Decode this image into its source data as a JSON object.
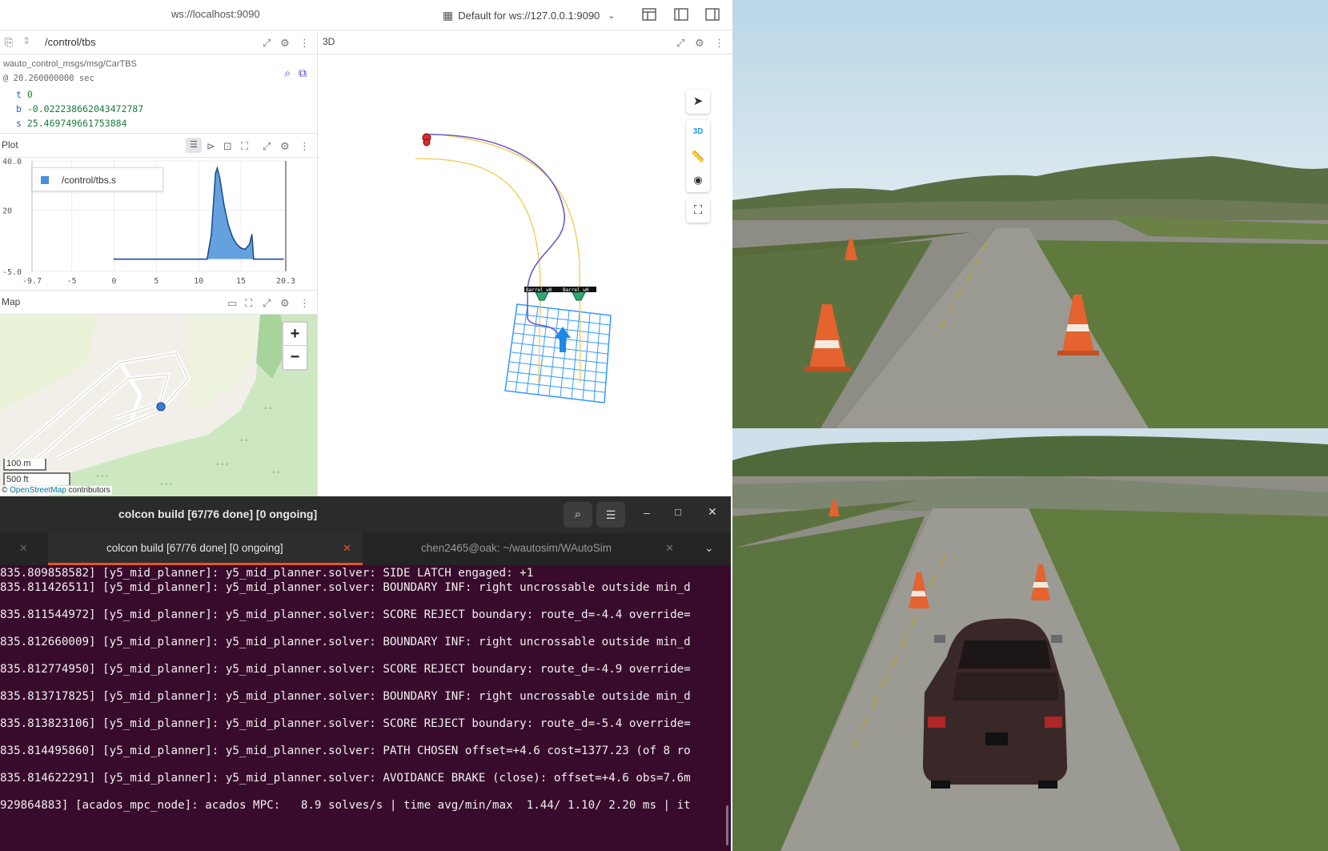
{
  "topbar": {
    "connection": "ws://localhost:9090",
    "layout_label": "Default for ws://127.0.0.1:9090"
  },
  "raw_panel": {
    "topic": "/control/tbs",
    "msg_type": "wauto_control_msgs/msg/CarTBS",
    "timestamp": "@ 20.260000000 sec",
    "fields": [
      {
        "key": "t",
        "value": "0"
      },
      {
        "key": "b",
        "value": "-0.022238662043472787"
      },
      {
        "key": "s",
        "value": "25.469749661753884"
      }
    ]
  },
  "plot_panel": {
    "title": "Plot",
    "legend_series": "/control/tbs.s",
    "series_color": "#4a90d9"
  },
  "chart_data": {
    "type": "area",
    "title": "",
    "xlabel": "",
    "ylabel": "",
    "xlim": [
      -9.7,
      20.3
    ],
    "ylim": [
      -5.0,
      40.0
    ],
    "x_ticks": [
      "-9.7",
      "-5",
      "0",
      "5",
      "10",
      "15",
      "20.3"
    ],
    "y_ticks": [
      "40.0",
      "20",
      "-5.0"
    ],
    "grid": true,
    "legend_position": "top-left",
    "series": [
      {
        "name": "/control/tbs.s",
        "x": [
          0,
          11,
          11.5,
          11.8,
          12,
          12.2,
          12.5,
          13,
          13.5,
          14,
          14.5,
          15,
          15.5,
          16,
          16.3,
          16.5,
          20
        ],
        "y": [
          0,
          0,
          10,
          25,
          35,
          37,
          33,
          22,
          14,
          9,
          6,
          4.5,
          4,
          6,
          10,
          0,
          0
        ]
      }
    ]
  },
  "map_panel": {
    "title": "Map",
    "zoom_in": "+",
    "zoom_out": "−",
    "scale_metric": "100 m",
    "scale_imperial": "500 ft",
    "attribution_prefix": "©",
    "attribution_link": "OpenStreetMap",
    "attribution_suffix": "contributors"
  },
  "panel3d": {
    "title": "3D",
    "mode_3d": "3D",
    "overlay_label_1": "Barrel_w0",
    "overlay_label_2": "Barrel_w0"
  },
  "terminal": {
    "window_title": "colcon build [67/76 done] [0 ongoing]",
    "tabs": [
      {
        "label": "colcon build [67/76 done] [0 ongoing]",
        "active": true
      },
      {
        "label": "chen2465@oak: ~/wautosim/WAutoSim",
        "active": false
      }
    ],
    "lines": [
      "835.809858582] [y5_mid_planner]: y5_mid_planner.solver: SIDE LATCH engaged: +1",
      "835.811426511] [y5_mid_planner]: y5_mid_planner.solver: BOUNDARY INF: right uncrossable outside min_d",
      "835.811544972] [y5_mid_planner]: y5_mid_planner.solver: SCORE REJECT boundary: route_d=-4.4 override=",
      "835.812660009] [y5_mid_planner]: y5_mid_planner.solver: BOUNDARY INF: right uncrossable outside min_d",
      "835.812774950] [y5_mid_planner]: y5_mid_planner.solver: SCORE REJECT boundary: route_d=-4.9 override=",
      "835.813717825] [y5_mid_planner]: y5_mid_planner.solver: BOUNDARY INF: right uncrossable outside min_d",
      "835.813823106] [y5_mid_planner]: y5_mid_planner.solver: SCORE REJECT boundary: route_d=-5.4 override=",
      "835.814495860] [y5_mid_planner]: y5_mid_planner.solver: PATH CHOSEN offset=+4.6 cost=1377.23 (of 8 ro",
      "835.814622291] [y5_mid_planner]: y5_mid_planner.solver: AVOIDANCE BRAKE (close): offset=+4.6 obs=7.6m",
      "929864883] [acados_mpc_node]: acados MPC:   8.9 solves/s | time avg/min/max  1.44/ 1.10/ 2.20 ms | it"
    ]
  },
  "colors": {
    "terminal_bg": "#380b2c",
    "accent_orange": "#e95420",
    "plot_fill": "#4a90d9",
    "path_purple": "#6a5acd",
    "path_yellow": "#f2c94c",
    "grid_blue": "#3399ff"
  }
}
